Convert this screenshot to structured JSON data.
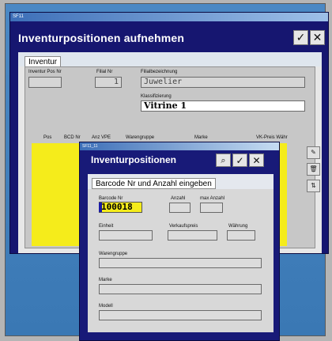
{
  "outer_window": {
    "small_title": "SF11",
    "title": "Inventurpositionen aufnehmen",
    "ok_symbol": "✓",
    "close_symbol": "✕",
    "tab_label": "Inventur",
    "fields": {
      "inventur_pos_nr_label": "Inventur Pos Nr",
      "inventur_pos_nr_value": "",
      "filial_nr_label": "Filial Nr",
      "filial_nr_value": "1",
      "filialbezeichnung_label": "Filialbezeichnung",
      "filialbezeichnung_value": "Juwelier",
      "klassifizierung_label": "Klassifizierung",
      "klassifizierung_value": "Vitrine 1"
    },
    "table_headers": [
      "Pos",
      "BCD Nr",
      "Anz VPE",
      "Warengruppe",
      "Marke",
      "VK-Preis Währ"
    ],
    "side_buttons": [
      "✎",
      "🗑",
      "⇅"
    ]
  },
  "inner_window": {
    "small_title": "SF11_11",
    "title": "Inventurpositionen",
    "search_symbol": "⌕",
    "ok_symbol": "✓",
    "close_symbol": "✕",
    "tab_label": "Barcode Nr und Anzahl eingeben",
    "fields": {
      "barcode_label": "Barcode Nr",
      "barcode_value": "100018",
      "anzahl_label": "Anzahl",
      "max_anzahl_label": "max Anzahl",
      "einheit_label": "Einheit",
      "verkaufspreis_label": "Verkaufspreis",
      "waehrung_label": "Währung",
      "warengruppe_label": "Warengruppe",
      "marke_label": "Marke",
      "modell_label": "Modell"
    }
  }
}
